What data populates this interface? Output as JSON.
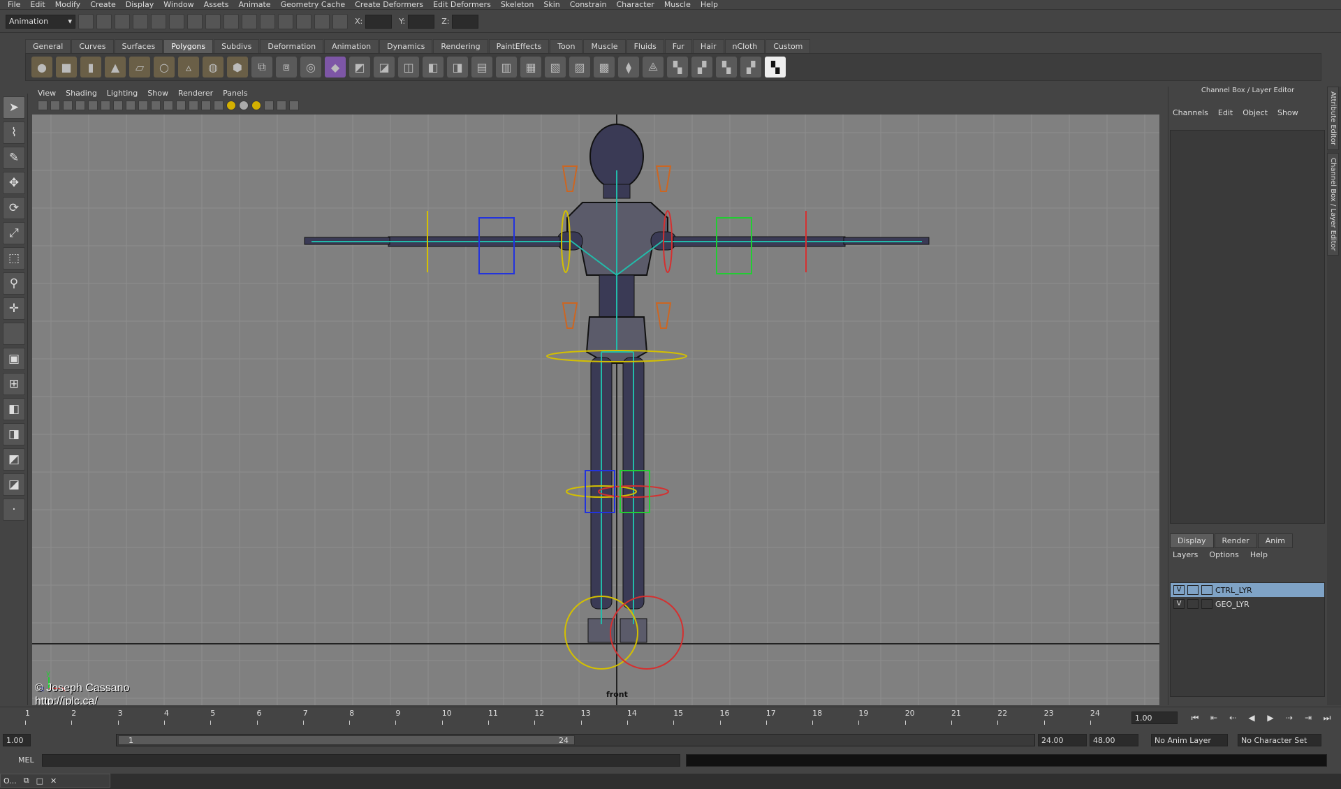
{
  "menubar": [
    "File",
    "Edit",
    "Modify",
    "Create",
    "Display",
    "Window",
    "Assets",
    "Animate",
    "Geometry Cache",
    "Create Deformers",
    "Edit Deformers",
    "Skeleton",
    "Skin",
    "Constrain",
    "Character",
    "Muscle",
    "Help"
  ],
  "statusline": {
    "mode": "Animation",
    "x_label": "X:",
    "y_label": "Y:",
    "z_label": "Z:"
  },
  "shelf_tabs": [
    "General",
    "Curves",
    "Surfaces",
    "Polygons",
    "Subdivs",
    "Deformation",
    "Animation",
    "Dynamics",
    "Rendering",
    "PaintEffects",
    "Toon",
    "Muscle",
    "Fluids",
    "Fur",
    "Hair",
    "nCloth",
    "Custom"
  ],
  "active_shelf_tab": "Polygons",
  "viewport": {
    "menu": [
      "View",
      "Shading",
      "Lighting",
      "Show",
      "Renderer",
      "Panels"
    ],
    "camera": "front"
  },
  "watermark": {
    "line1": "© Joseph Cassano",
    "line2": "http://jplc.ca/"
  },
  "axis": {
    "y": "y",
    "x": "x",
    "z": "z"
  },
  "channel_box": {
    "title": "Channel Box / Layer Editor",
    "menu": [
      "Channels",
      "Edit",
      "Object",
      "Show"
    ],
    "layer_tabs": [
      "Display",
      "Render",
      "Anim"
    ],
    "layer_menu": [
      "Layers",
      "Options",
      "Help"
    ],
    "layers": [
      {
        "v": "V",
        "name": "CTRL_LYR",
        "selected": true
      },
      {
        "v": "V",
        "name": "GEO_LYR",
        "selected": false
      }
    ]
  },
  "side_tabs": [
    "Attribute Editor",
    "Channel Box / Layer Editor"
  ],
  "timeline": {
    "ticks": [
      "1",
      "2",
      "3",
      "4",
      "5",
      "6",
      "7",
      "8",
      "9",
      "10",
      "11",
      "12",
      "13",
      "14",
      "15",
      "16",
      "17",
      "18",
      "19",
      "20",
      "21",
      "22",
      "23",
      "24"
    ],
    "current_time": "1.00"
  },
  "range": {
    "start": "1.00",
    "inner_start": "1",
    "inner_end": "24",
    "end": "24.00",
    "max": "48.00",
    "anim_layer": "No Anim Layer",
    "char_set": "No Character Set"
  },
  "cmd": {
    "label": "MEL"
  },
  "taskbar": {
    "item": "O..."
  }
}
